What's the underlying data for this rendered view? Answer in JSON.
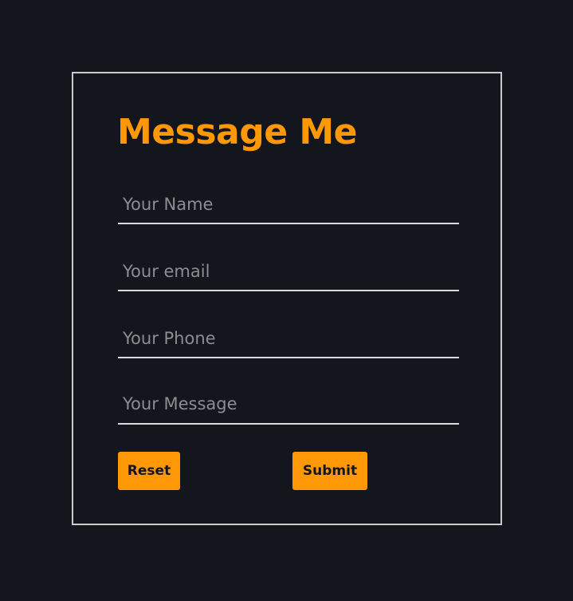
{
  "form": {
    "title": "Message Me",
    "fields": {
      "name_placeholder": "Your Name",
      "email_placeholder": "Your email",
      "phone_placeholder": "Your Phone",
      "message_placeholder": "Your Message"
    },
    "buttons": {
      "reset_label": "Reset",
      "submit_label": "Submit"
    }
  },
  "colors": {
    "background": "#13161d",
    "accent": "#ff9807",
    "border": "#c9cacc",
    "placeholder": "#8b8d91"
  }
}
